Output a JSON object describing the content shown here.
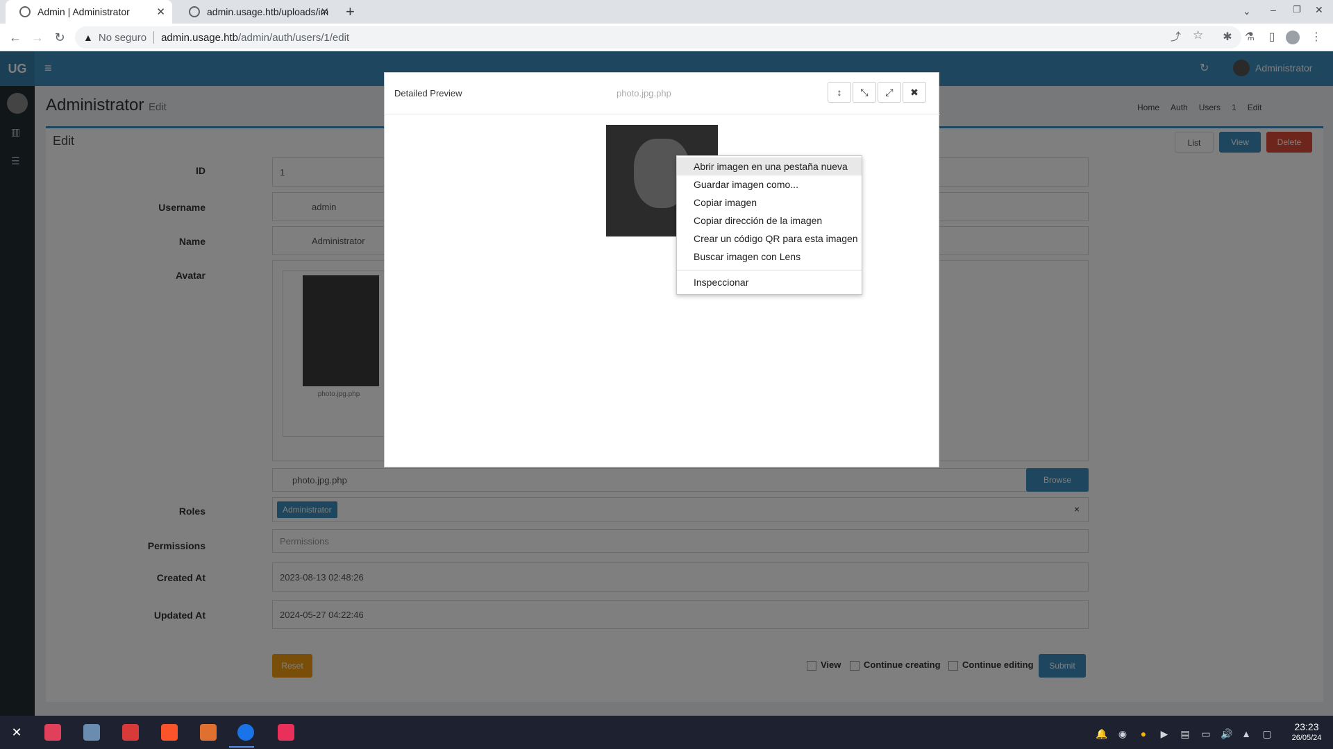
{
  "browser": {
    "tabs": [
      {
        "title": "Admin | Administrator",
        "active": true
      },
      {
        "title": "admin.usage.htb/uploads/im",
        "active": false
      }
    ],
    "security_label": "No seguro",
    "url_host": "admin.usage.htb",
    "url_path": "/admin/auth/users/1/edit"
  },
  "app": {
    "logo": "UG",
    "user_name": "Administrator",
    "page_title": "Administrator",
    "page_subtitle": "Edit",
    "breadcrumb": [
      "Home",
      "Auth",
      "Users",
      "1",
      "Edit"
    ],
    "box_title": "Edit",
    "actions": {
      "list": "List",
      "view": "View",
      "delete": "Delete"
    },
    "form": {
      "id_label": "ID",
      "id_value": "1",
      "username_label": "Username",
      "username_value": "admin",
      "name_label": "Name",
      "name_value": "Administrator",
      "avatar_label": "Avatar",
      "avatar_caption": "photo.jpg.php",
      "file_name": "photo.jpg.php",
      "browse_label": "Browse",
      "roles_label": "Roles",
      "role_tag": "Administrator",
      "roles_clear": "×",
      "permissions_label": "Permissions",
      "permissions_placeholder": "Permissions",
      "created_label": "Created At",
      "created_value": "2023-08-13 02:48:26",
      "updated_label": "Updated At",
      "updated_value": "2024-05-27 04:22:46",
      "reset_label": "Reset",
      "view_check": "View",
      "continue_creating": "Continue creating",
      "continue_editing": "Continue editing",
      "submit_label": "Submit"
    }
  },
  "modal": {
    "title": "Detailed Preview",
    "filename": "photo.jpg.php"
  },
  "context_menu": {
    "items": [
      "Abrir imagen en una pestaña nueva",
      "Guardar imagen como...",
      "Copiar imagen",
      "Copiar dirección de la imagen",
      "Crear un código QR para esta imagen",
      "Buscar imagen con Lens"
    ],
    "inspect": "Inspeccionar"
  },
  "taskbar": {
    "time": "23:23",
    "date": "26/05/24"
  },
  "colors": {
    "primary": "#3c8dbc",
    "danger": "#dd4b39",
    "warning": "#f39c12",
    "sidebar": "#222d32",
    "info": "#00c0ef"
  }
}
